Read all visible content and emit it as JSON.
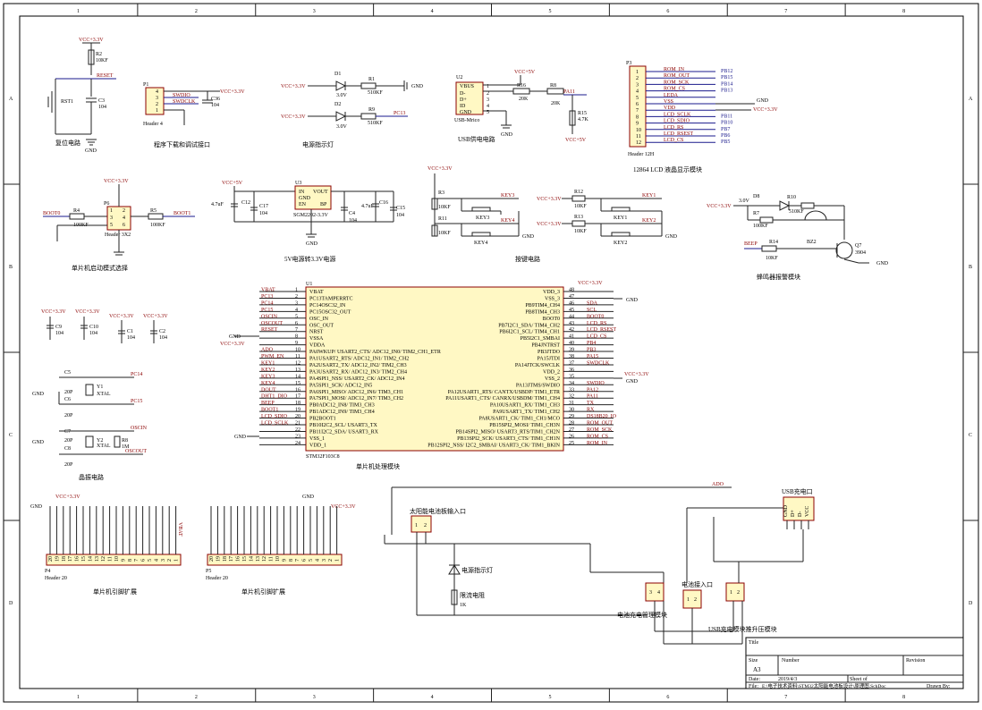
{
  "border": {
    "cols": [
      "1",
      "2",
      "3",
      "4",
      "5",
      "6",
      "7",
      "8"
    ],
    "rows": [
      "A",
      "B",
      "C",
      "D"
    ]
  },
  "power": {
    "vcc33": "VCC+3.3V",
    "vcc5": "VCC+5V",
    "gnd": "GND"
  },
  "blocks": {
    "reset": {
      "caption": "复位电路",
      "sw": "RST1",
      "r": "R2",
      "rv": "10KF",
      "c": "C3",
      "cv": "104",
      "net": "RESET"
    },
    "prog": {
      "caption": "程序下载和调试接口",
      "ref": "P1",
      "part": "Header 4",
      "n1": "SWDIO",
      "n2": "SWDCLK",
      "c": "C36",
      "cv": "104",
      "pins": [
        "4",
        "3",
        "2",
        "1"
      ]
    },
    "led": {
      "caption": "电源指示灯",
      "d1": "D1",
      "d1v": "3.0V",
      "r1": "R1",
      "r1v": "510KF",
      "d2": "D2",
      "d2v": "3.0V",
      "r2": "R9",
      "r2v": "510KF",
      "net": "PC13"
    },
    "usb": {
      "caption": "USB供电电路",
      "ref": "U2",
      "part": "USB-Mrico",
      "pins": [
        "VBUS",
        "D-",
        "D+",
        "ID",
        "GND"
      ],
      "nums": [
        "1",
        "2",
        "3",
        "4",
        "5"
      ],
      "r16": "R16",
      "r16v": "20K",
      "r8": "R8",
      "r8v": "20K",
      "r15": "R15",
      "r15v": "4.7K",
      "net": "PA11"
    },
    "lcd": {
      "caption": "12864 LCD 液晶显示模块",
      "ref": "P3",
      "part": "Header 12H",
      "nets": [
        "ROM_IN",
        "ROM_OUT",
        "ROM_SCK",
        "ROM_CS",
        "LEDA",
        "VSS",
        "VDD",
        "LCD_SCLK",
        "LCD_SDIO",
        "LCD_RS",
        "LCD_RSEST",
        "LCD_CS"
      ],
      "pins": [
        "1",
        "2",
        "3",
        "4",
        "5",
        "6",
        "7",
        "8",
        "9",
        "10",
        "11",
        "12"
      ],
      "pb": [
        "PB12",
        "PB15",
        "PB14",
        "PB13",
        "",
        "",
        "",
        "PB11",
        "PB10",
        "PB7",
        "PB6",
        "PB5"
      ]
    },
    "boot": {
      "caption": "单片机启动模式选择",
      "ref": "P6",
      "part": "Header 3X2",
      "r4": "R4",
      "r4v": "100KF",
      "r5": "R5",
      "r5v": "100KF",
      "n0": "BOOT0",
      "n1": "BOOT1",
      "pins": [
        "1",
        "2",
        "3",
        "4",
        "5",
        "6"
      ]
    },
    "ldo": {
      "caption": "5V电源转3.3V电源",
      "ref": "U3",
      "part": "SGM2202-3.3V",
      "p1": "IN",
      "p2": "GND",
      "p3": "EN",
      "p4": "VOUT",
      "p5": "BP",
      "c12": "C12",
      "c12v": "4.7uF",
      "c17": "C17",
      "c17v": "104",
      "c4": "C4",
      "c4v": "104",
      "c16": "C16",
      "c16v": "4.7uF",
      "c15": "C15",
      "c15v": "104"
    },
    "keys": {
      "caption": "按键电路",
      "r3": "R3",
      "r11": "R11",
      "r12": "R12",
      "r13": "R13",
      "rv": "10KF",
      "k3": "KEY3",
      "k4": "KEY4",
      "k1": "KEY1",
      "k2": "KEY2"
    },
    "buzz": {
      "caption": "蜂鸣器报警模块",
      "d8": "D8",
      "d8v": "3.0V",
      "r10": "R10",
      "r10v": "510KF",
      "r7": "R7",
      "r7v": "100KF",
      "r14": "R14",
      "r14v": "10KF",
      "bz": "BZ2",
      "q": "Q7",
      "qv": "3904",
      "net": "BEEP"
    },
    "caps": {
      "c9": "C9",
      "c10": "C10",
      "c1": "C1",
      "c2": "C2",
      "v": "104"
    },
    "xtal": {
      "caption": "晶振电路",
      "c5": "C5",
      "c6": "C6",
      "c7": "C7",
      "c8": "C8",
      "cv": "20P",
      "y1": "Y1",
      "y2": "Y2",
      "yv": "XTAL",
      "r8": "R8",
      "r8v": "1M",
      "n1": "PC14",
      "n2": "PC15",
      "n3": "OSCIN",
      "n4": "OSCOUT"
    },
    "mcu": {
      "caption": "单片机处理模块",
      "ref": "U1",
      "part": "STM32F103C8",
      "left": [
        {
          "net": "VBAT",
          "n": "1",
          "f": "VBAT"
        },
        {
          "net": "PC13",
          "n": "2",
          "f": "PC13TAMPERRTC"
        },
        {
          "net": "PC14",
          "n": "3",
          "f": "PC14OSC32_IN"
        },
        {
          "net": "PC15",
          "n": "4",
          "f": "PC15OSC32_OUT"
        },
        {
          "net": "OSCIN",
          "n": "5",
          "f": "OSC_IN"
        },
        {
          "net": "OSCOUT",
          "n": "6",
          "f": "OSC_OUT"
        },
        {
          "net": "RESET",
          "n": "7",
          "f": "NRST"
        },
        {
          "net": "",
          "n": "8",
          "f": "VSSA"
        },
        {
          "net": "",
          "n": "9",
          "f": "VDDA"
        },
        {
          "net": "ADO",
          "n": "10",
          "f": "PA0WKUP/ USART2_CTS/ ADC12_IN0/ TIM2_CH1_ETR"
        },
        {
          "net": "PWM_EN",
          "n": "11",
          "f": "PA1USART2_RTS/ ADC12_IN1/ TIM2_CH2"
        },
        {
          "net": "KEY1",
          "n": "12",
          "f": "PA2USART2_TX/ ADC12_IN2/ TIM2_CH3"
        },
        {
          "net": "KEY2",
          "n": "13",
          "f": "PA3USART2_RX/ ADC12_IN3/ TIM2_CH4"
        },
        {
          "net": "KEY3",
          "n": "14",
          "f": "PA4SPI1_NSS/ USART2_CK/ ADC12_IN4"
        },
        {
          "net": "KEY4",
          "n": "15",
          "f": "PA5SPI1_SCK/ ADC12_IN5"
        },
        {
          "net": "DOUT",
          "n": "16",
          "f": "PA6SPI1_MISO/ ADC12_IN6/ TIM3_CH1"
        },
        {
          "net": "DHT1_DIO",
          "n": "17",
          "f": "PA7SPI1_MOSI/ ADC12_IN7/ TIM3_CH2"
        },
        {
          "net": "BEEP",
          "n": "18",
          "f": "PB0ADC12_IN8/ TIM3_CH3"
        },
        {
          "net": "BOOT1",
          "n": "19",
          "f": "PB1ADC12_IN9/ TIM3_CH4"
        },
        {
          "net": "LCD_SDIO",
          "n": "20",
          "f": "PB2BOOT1"
        },
        {
          "net": "LCD_SCLK",
          "n": "21",
          "f": "PB10I2C2_SCL/ USART3_TX"
        },
        {
          "net": "",
          "n": "22",
          "f": "PB11I2C2_SDA/ USART3_RX"
        },
        {
          "net": "",
          "n": "23",
          "f": "VSS_1"
        },
        {
          "net": "",
          "n": "24",
          "f": "VDD_1"
        }
      ],
      "right": [
        {
          "net": "",
          "n": "48",
          "f": "VDD_3"
        },
        {
          "net": "",
          "n": "47",
          "f": "VSS_3"
        },
        {
          "net": "SDA",
          "n": "46",
          "f": "PB9TIM4_CH4"
        },
        {
          "net": "SCL",
          "n": "45",
          "f": "PB8TIM4_CH3"
        },
        {
          "net": "BOOT0",
          "n": "44",
          "f": "BOOT0"
        },
        {
          "net": "LCD_RS",
          "n": "43",
          "f": "PB7I2C1_SDA/ TIM4_CH2"
        },
        {
          "net": "LCD_RSEST",
          "n": "42",
          "f": "PB6I2C1_SCL/ TIM4_CH1"
        },
        {
          "net": "LCD_CS",
          "n": "41",
          "f": "PB5I2C1_SMBAI"
        },
        {
          "net": "PB4",
          "n": "40",
          "f": "PB4JNTRST"
        },
        {
          "net": "PB3",
          "n": "39",
          "f": "PB3JTDO"
        },
        {
          "net": "PA15",
          "n": "38",
          "f": "PA15JTDI"
        },
        {
          "net": "SWDCLK",
          "n": "37",
          "f": "PA14JTCK/SWCLK"
        },
        {
          "net": "",
          "n": "36",
          "f": "VDD_2"
        },
        {
          "net": "",
          "n": "35",
          "f": "VSS_2"
        },
        {
          "net": "SWDIO",
          "n": "34",
          "f": "PA13JTMS/SWDIO"
        },
        {
          "net": "PA12",
          "n": "33",
          "f": "PA12USART1_RTS/ CANTX/USBDP/ TIM1_ETR"
        },
        {
          "net": "PA11",
          "n": "32",
          "f": "PA11USART1_CTS/ CANRX/USBDM/ TIM1_CH4"
        },
        {
          "net": "TX",
          "n": "31",
          "f": "PA10USART1_RX/ TIM1_CH3"
        },
        {
          "net": "RX",
          "n": "30",
          "f": "PA9USART1_TX/ TIM1_CH2"
        },
        {
          "net": "DS18B20_IO",
          "n": "29",
          "f": "PA8USART1_CK/ TIM1_CH1/MCO"
        },
        {
          "net": "ROM_OUT",
          "n": "28",
          "f": "PB15SPI2_MOSI/ TIM1_CH3N"
        },
        {
          "net": "ROM_SCK",
          "n": "27",
          "f": "PB14SPI2_MISO/ USART3_RTS/TIM1_CH2N"
        },
        {
          "net": "ROM_CS",
          "n": "26",
          "f": "PB13SPI2_SCK/ USART3_CTS/ TIM1_CH1N"
        },
        {
          "net": "ROM_IN",
          "n": "25",
          "f": "PB12SPI2_NSS/ I2C2_SMBAI/ USART3_CK/ TIM1_BKIN"
        }
      ]
    },
    "p4": {
      "caption": "单片机引脚扩展",
      "ref": "P4",
      "part": "Header 20",
      "vbat": "VBAT"
    },
    "p5": {
      "caption": "单片机引脚扩展",
      "ref": "P5",
      "part": "Header 20"
    },
    "solar": {
      "in": "太阳能电池板输入口",
      "led": "电源指示灯",
      "r": "限流电阻",
      "rv": "1K",
      "ado": "ADO",
      "usb": "USB充电口",
      "usbpins": [
        "GND",
        "D+",
        "D-",
        "VCC"
      ],
      "charge": "电池充电管理模块",
      "batt": "电池接入口",
      "boost": "USB充电模块推升压模块"
    }
  },
  "titleblock": {
    "title": "Title",
    "size": "Size",
    "sizev": "A3",
    "number": "Number",
    "revision": "Revision",
    "date": "Date:",
    "datev": "2019/4/3",
    "sheet": "Sheet  of",
    "file": "File:",
    "filev": "E:\\电子技术资料\\STM32太阳能电池板设计\\原理图.SchDoc",
    "drawn": "Drawn By:"
  }
}
